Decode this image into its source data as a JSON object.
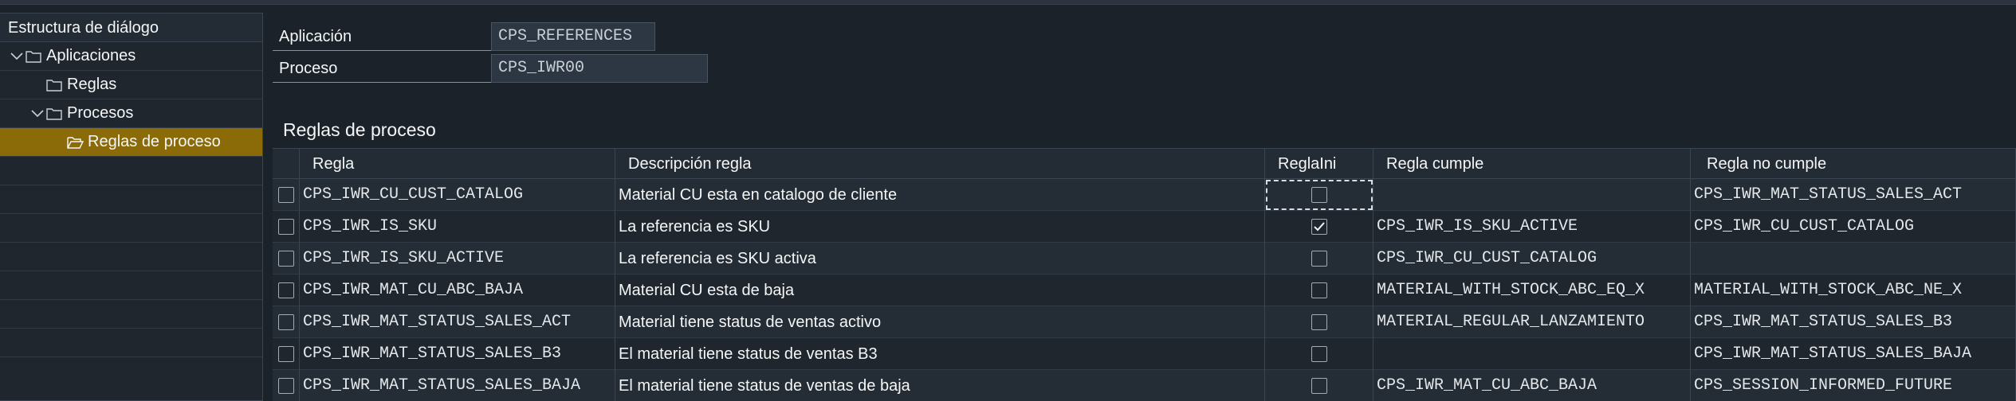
{
  "tree": {
    "header": "Estructura de diálogo",
    "items": [
      {
        "label": "Aplicaciones",
        "expanded": true,
        "level": 0
      },
      {
        "label": "Reglas",
        "expanded": false,
        "level": 1
      },
      {
        "label": "Procesos",
        "expanded": true,
        "level": 1
      },
      {
        "label": "Reglas de proceso",
        "expanded": false,
        "level": 2,
        "selected": true
      }
    ]
  },
  "form": {
    "aplicacion_label": "Aplicación",
    "aplicacion_value": "CPS_REFERENCES",
    "proceso_label": "Proceso",
    "proceso_value": "CPS_IWR00"
  },
  "section": {
    "title": "Reglas de proceso"
  },
  "table": {
    "columns": [
      "Regla",
      "Descripción regla",
      "ReglaIni",
      "Regla cumple",
      "Regla no cumple"
    ],
    "rows": [
      {
        "regla": "CPS_IWR_CU_CUST_CATALOG",
        "descripcion": "Material CU esta en catalogo de cliente",
        "reglaini": false,
        "cumple": "",
        "no_cumple": "CPS_IWR_MAT_STATUS_SALES_ACT"
      },
      {
        "regla": "CPS_IWR_IS_SKU",
        "descripcion": "La referencia es SKU",
        "reglaini": true,
        "cumple": "CPS_IWR_IS_SKU_ACTIVE",
        "no_cumple": "CPS_IWR_CU_CUST_CATALOG"
      },
      {
        "regla": "CPS_IWR_IS_SKU_ACTIVE",
        "descripcion": "La referencia es SKU activa",
        "reglaini": false,
        "cumple": "CPS_IWR_CU_CUST_CATALOG",
        "no_cumple": ""
      },
      {
        "regla": "CPS_IWR_MAT_CU_ABC_BAJA",
        "descripcion": "Material CU esta de baja",
        "reglaini": false,
        "cumple": "MATERIAL_WITH_STOCK_ABC_EQ_X",
        "no_cumple": "MATERIAL_WITH_STOCK_ABC_NE_X"
      },
      {
        "regla": "CPS_IWR_MAT_STATUS_SALES_ACT",
        "descripcion": "Material tiene status de ventas activo",
        "reglaini": false,
        "cumple": "MATERIAL_REGULAR_LANZAMIENTO",
        "no_cumple": "CPS_IWR_MAT_STATUS_SALES_B3"
      },
      {
        "regla": "CPS_IWR_MAT_STATUS_SALES_B3",
        "descripcion": "El material tiene status de ventas B3",
        "reglaini": false,
        "cumple": "",
        "no_cumple": "CPS_IWR_MAT_STATUS_SALES_BAJA"
      },
      {
        "regla": "CPS_IWR_MAT_STATUS_SALES_BAJA",
        "descripcion": "El material tiene status de ventas de baja",
        "reglaini": false,
        "cumple": "CPS_IWR_MAT_CU_ABC_BAJA",
        "no_cumple": "CPS_SESSION_INFORMED_FUTURE"
      }
    ]
  },
  "colors": {
    "background": "#1c2229",
    "selected_node": "#8a6b08",
    "input_bg": "#2d3743"
  },
  "icons": [
    "chevron-down-icon",
    "folder-icon",
    "open-folder-icon",
    "checkbox-icon",
    "checkmark-icon"
  ]
}
